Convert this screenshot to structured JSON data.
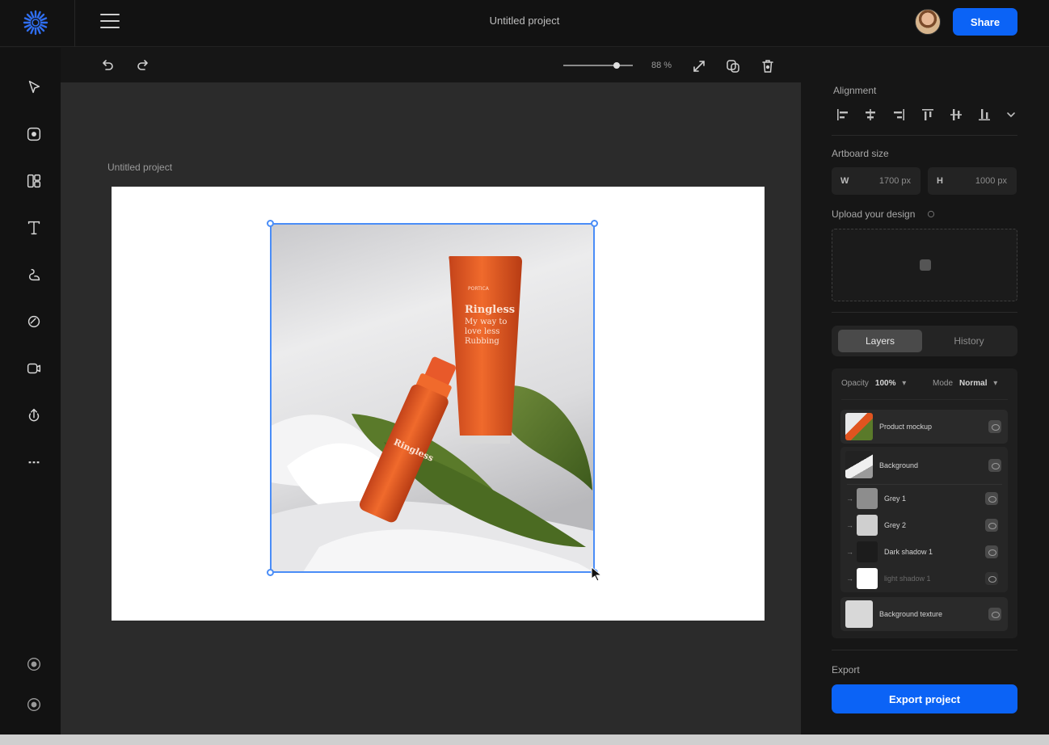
{
  "header": {
    "title": "Untitled project",
    "share_label": "Share"
  },
  "tools": [
    {
      "name": "select-tool",
      "icon": "pointer-icon"
    },
    {
      "name": "frame-tool",
      "icon": "frame-icon"
    },
    {
      "name": "templates-tool",
      "icon": "layout-icon"
    },
    {
      "name": "text-tool",
      "icon": "text-icon"
    },
    {
      "name": "draw-tool",
      "icon": "pen-icon"
    },
    {
      "name": "effects-tool",
      "icon": "circle-icon"
    },
    {
      "name": "video-tool",
      "icon": "video-icon"
    },
    {
      "name": "upload-tool",
      "icon": "upload-icon"
    },
    {
      "name": "more-tool",
      "icon": "more-icon"
    }
  ],
  "canvas": {
    "zoom_label": "88 %",
    "zoom_level": 0.8,
    "artboard_label": "Untitled project",
    "product": {
      "tube_brand": "PORTICA",
      "tube_text": "Ringless My way to love less Rubbing",
      "bottle_text": "Ringless"
    }
  },
  "panel": {
    "alignment_label": "Alignment",
    "artboard_size_label": "Artboard size",
    "width_key": "W",
    "width_value": "1700 px",
    "height_key": "H",
    "height_value": "1000 px",
    "upload_label": "Upload your design",
    "tabs": {
      "layers": "Layers",
      "history": "History"
    },
    "opacity_label": "Opacity",
    "opacity_value": "100%",
    "blend_label": "Mode",
    "blend_value": "Normal",
    "layers": [
      {
        "name": "Product mockup"
      },
      {
        "name": "Background"
      },
      {
        "name": "Grey 1"
      },
      {
        "name": "Grey 2"
      },
      {
        "name": "Dark shadow 1"
      },
      {
        "name": "light shadow 1"
      },
      {
        "name": "Background texture"
      }
    ],
    "export_label": "Export",
    "export_button": "Export project"
  },
  "colors": {
    "accent": "#0b63f6",
    "selection": "#4a8df7",
    "product_orange": "#e0541f"
  }
}
